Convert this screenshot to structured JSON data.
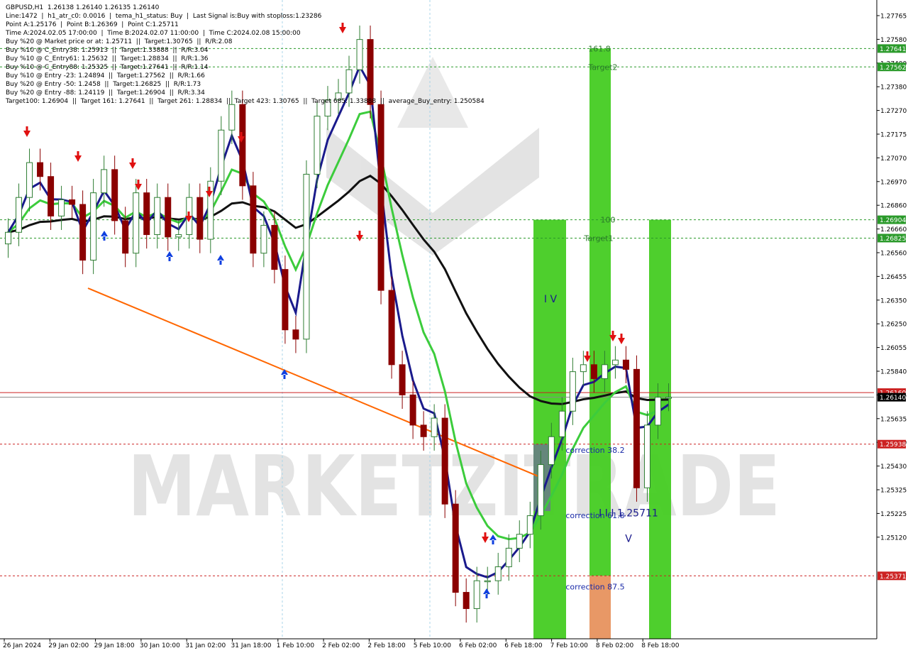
{
  "header": {
    "symbol_line": "GBPUSD,H1  1.26138 1.26140 1.26135 1.26140",
    "lines": [
      "Line:1472  |  h1_atr_c0: 0.0016  |  tema_h1_status: Buy  |  Last Signal is:Buy with stoploss:1.23286",
      "Point A:1.25176  |  Point B:1.26369  |  Point C:1.25711",
      "Time A:2024.02.05 17:00:00  |  Time B:2024.02.07 11:00:00  |  Time C:2024.02.08 15:00:00",
      "Buy %20 @ Market price or at: 1.25711  ||  Target:1.30765  ||  R/R:2.08",
      "Buy %10 @ C_Entry38: 1.25913  ||  Target:1.33888  ||  R/R:3.04",
      "Buy %10 @ C_Entry61: 1.25632  ||  Target:1.28834  ||  R/R:1.36",
      "Buy %10 @ C_Entry88: 1.25325  ||  Target:1.27641  ||  R/R:1.14",
      "Buy %10 @ Entry -23: 1.24894  ||  Target:1.27562  ||  R/R:1.66",
      "Buy %20 @ Entry -50: 1.2458  ||  Target:1.26825  ||  R/R:1.73",
      "Buy %20 @ Entry -88: 1.24119  ||  Target:1.26904  ||  R/R:3.34",
      "Target100: 1.26904  ||  Target 161: 1.27641  ||  Target 261: 1.28834  ||  Target 423: 1.30765  ||  Target 685: 1.33888  ||  average_Buy_entry: 1.250584"
    ]
  },
  "colors": {
    "background": "#ffffff",
    "bull_candle": "#2e7d32",
    "bear_candle": "#8b0000",
    "zone_green": "#44cc22",
    "zone_orange": "#e89866",
    "zone_slate": "#6a7a8a",
    "ma_navy": "#1a1a8c",
    "ma_green": "#3ccc3c",
    "ma_black": "#111111",
    "trendline": "#ff6600",
    "level_green": "#2a9a2a",
    "level_red": "#cc2222",
    "price_line": "#cc0000"
  },
  "watermark": "MARKETZITRADE",
  "chart_data": {
    "type": "candlestick",
    "symbol": "GBPUSD",
    "timeframe": "H1",
    "ylim": [
      1.251,
      1.2785
    ],
    "y_ticks": [
      "1.27765",
      "1.27580",
      "1.27400",
      "1.27380",
      "1.27270",
      "1.27175",
      "1.27070",
      "1.26970",
      "1.26860",
      "1.26660",
      "1.26560",
      "1.26455",
      "1.26350",
      "1.26250",
      "1.26055",
      "1.25840",
      "1.25735",
      "1.25635",
      "1.25530",
      "1.25430",
      "1.25325",
      "1.25225",
      "1.25120"
    ],
    "x_labels": [
      "26 Jan 2024",
      "29 Jan 02:00",
      "29 Jan 18:00",
      "30 Jan 10:00",
      "31 Jan 02:00",
      "31 Jan 18:00",
      "1 Feb 10:00",
      "2 Feb 02:00",
      "2 Feb 18:00",
      "5 Feb 10:00",
      "6 Feb 02:00",
      "6 Feb 18:00",
      "7 Feb 10:00",
      "8 Feb 02:00",
      "8 Feb 18:00"
    ],
    "level_labels": [
      {
        "value": 1.27641,
        "text": "1.27641",
        "kind": "green"
      },
      {
        "value": 1.27562,
        "text": "1.27562",
        "kind": "green"
      },
      {
        "value": 1.26904,
        "text": "1.26904",
        "kind": "green"
      },
      {
        "value": 1.26825,
        "text": "1.26825",
        "kind": "green"
      },
      {
        "value": 1.2616,
        "text": "1.26160",
        "kind": "red"
      },
      {
        "value": 1.2614,
        "text": "1.26140",
        "kind": "current"
      },
      {
        "value": 1.25938,
        "text": "1.25938",
        "kind": "red"
      },
      {
        "value": 1.25371,
        "text": "1.25371",
        "kind": "red"
      }
    ],
    "annotations": [
      {
        "text": "161.8",
        "x": "8 Feb 02:00",
        "y": 1.27641
      },
      {
        "text": "Target2",
        "x": "8 Feb 02:00",
        "y": 1.27562
      },
      {
        "text": "100",
        "x": "8 Feb 02:00",
        "y": 1.26904
      },
      {
        "text": "Target1",
        "x": "8 Feb 02:00",
        "y": 1.26825
      },
      {
        "text": "I V",
        "x": "7 Feb 10:00",
        "y": 1.2656
      },
      {
        "text": "correction 38.2",
        "x": "7 Feb 10:00",
        "y": 1.25913
      },
      {
        "text": "correction 61.8",
        "x": "7 Feb 10:00",
        "y": 1.25632
      },
      {
        "text": "correction 87.5",
        "x": "7 Feb 10:00",
        "y": 1.25325
      },
      {
        "text": "I I I 1.25711",
        "x": "8 Feb 02:00",
        "y": 1.2564
      },
      {
        "text": "V",
        "x": "8 Feb 18:00",
        "y": 1.2553
      }
    ],
    "series": [
      {
        "name": "close",
        "points": [
          [
            0,
            1.2685
          ],
          [
            1,
            1.27
          ],
          [
            2,
            1.2715
          ],
          [
            3,
            1.2709
          ],
          [
            4,
            1.2692
          ],
          [
            5,
            1.2699
          ],
          [
            6,
            1.2697
          ],
          [
            7,
            1.2673
          ],
          [
            8,
            1.2702
          ],
          [
            9,
            1.2712
          ],
          [
            10,
            1.269
          ],
          [
            11,
            1.2676
          ],
          [
            12,
            1.2702
          ],
          [
            13,
            1.2684
          ],
          [
            14,
            1.27
          ],
          [
            15,
            1.2683
          ],
          [
            16,
            1.2684
          ],
          [
            17,
            1.27
          ],
          [
            18,
            1.2682
          ],
          [
            19,
            1.2707
          ],
          [
            20,
            1.2729
          ],
          [
            21,
            1.274
          ],
          [
            22,
            1.2705
          ],
          [
            23,
            1.2676
          ],
          [
            24,
            1.2688
          ],
          [
            25,
            1.2669
          ],
          [
            26,
            1.2643
          ],
          [
            27,
            1.2639
          ],
          [
            28,
            1.271
          ],
          [
            29,
            1.2735
          ],
          [
            30,
            1.2742
          ],
          [
            31,
            1.2745
          ],
          [
            32,
            1.2755
          ],
          [
            33,
            1.2768
          ],
          [
            34,
            1.274
          ],
          [
            35,
            1.266
          ],
          [
            36,
            1.2628
          ],
          [
            37,
            1.2615
          ],
          [
            38,
            1.2602
          ],
          [
            39,
            1.2597
          ],
          [
            40,
            1.2605
          ],
          [
            41,
            1.2568
          ],
          [
            42,
            1.253
          ],
          [
            43,
            1.2523
          ],
          [
            44,
            1.2535
          ],
          [
            45,
            1.2535
          ],
          [
            46,
            1.2541
          ],
          [
            47,
            1.2549
          ],
          [
            48,
            1.2555
          ],
          [
            49,
            1.2563
          ],
          [
            50,
            1.2585
          ],
          [
            51,
            1.2597
          ],
          [
            52,
            1.2608
          ],
          [
            53,
            1.2625
          ],
          [
            54,
            1.2628
          ],
          [
            55,
            1.2622
          ],
          [
            56,
            1.2628
          ],
          [
            57,
            1.263
          ],
          [
            58,
            1.2626
          ],
          [
            59,
            1.2575
          ],
          [
            60,
            1.2602
          ],
          [
            61,
            1.2614
          ],
          [
            62,
            1.2614
          ]
        ]
      }
    ]
  }
}
